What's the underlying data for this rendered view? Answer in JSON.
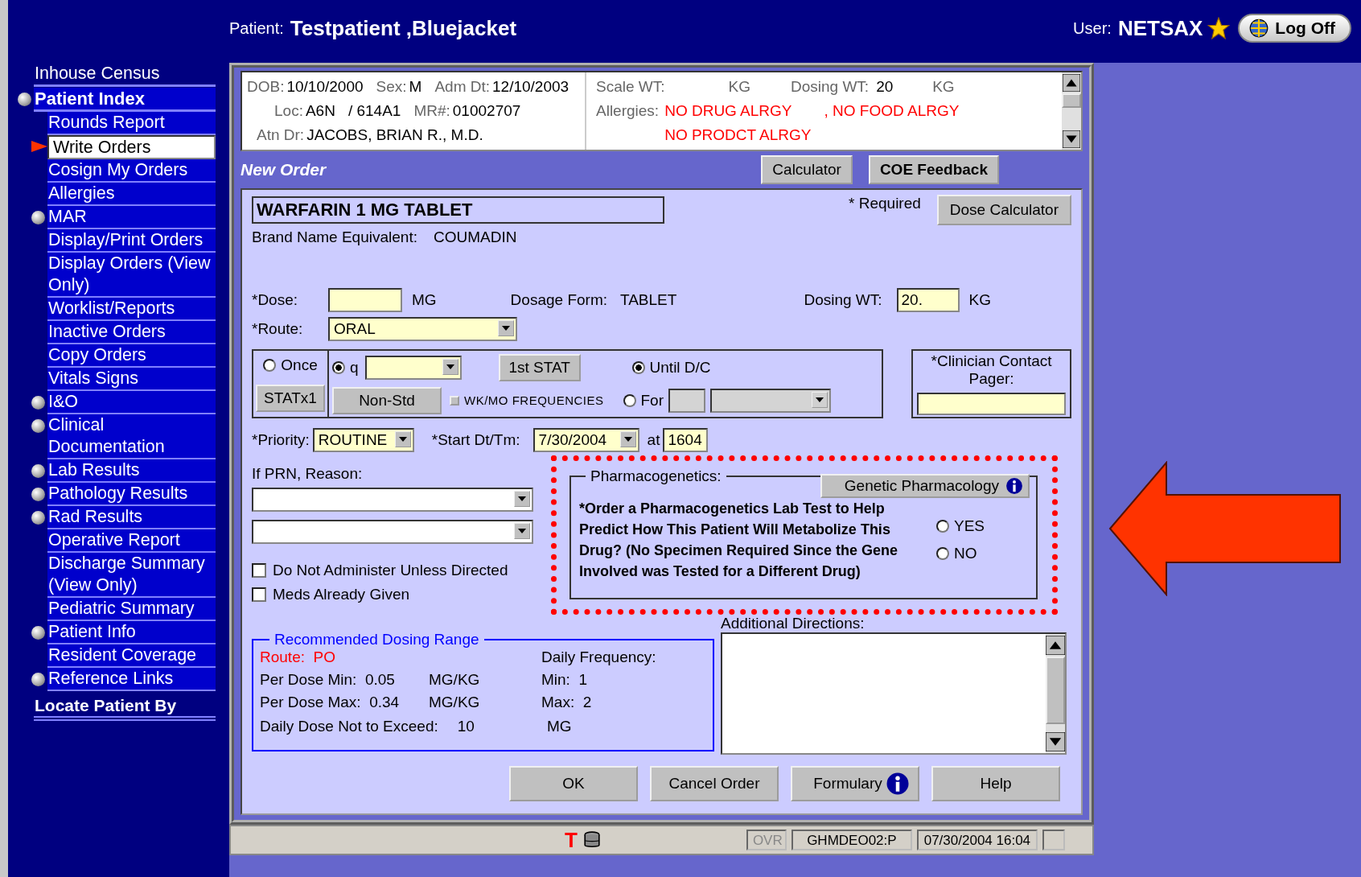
{
  "header": {
    "patient_label": "Patient:",
    "patient_name": "Testpatient ,Bluejacket",
    "user_label": "User:",
    "user_name": "NETSAX",
    "logoff": "Log Off"
  },
  "sidebar": [
    {
      "label": "Inhouse Census",
      "kind": "top",
      "bullet": false,
      "selected": false
    },
    {
      "label": "Patient Index",
      "kind": "section",
      "bullet": true,
      "selected": false
    },
    {
      "label": "Rounds Report",
      "kind": "item",
      "bullet": false,
      "selected": false
    },
    {
      "label": "Write Orders",
      "kind": "item",
      "bullet": false,
      "selected": true
    },
    {
      "label": "Cosign My Orders",
      "kind": "item",
      "bullet": false,
      "selected": false
    },
    {
      "label": "Allergies",
      "kind": "item",
      "bullet": false,
      "selected": false
    },
    {
      "label": "MAR",
      "kind": "item",
      "bullet": true,
      "selected": false
    },
    {
      "label": "Display/Print Orders",
      "kind": "item",
      "bullet": false,
      "selected": false
    },
    {
      "label": "Display Orders (View Only)",
      "kind": "item",
      "bullet": false,
      "selected": false
    },
    {
      "label": "Worklist/Reports",
      "kind": "item",
      "bullet": false,
      "selected": false
    },
    {
      "label": "Inactive Orders",
      "kind": "item",
      "bullet": false,
      "selected": false
    },
    {
      "label": "Copy Orders",
      "kind": "item",
      "bullet": false,
      "selected": false
    },
    {
      "label": "Vitals Signs",
      "kind": "item",
      "bullet": false,
      "selected": false
    },
    {
      "label": "I&O",
      "kind": "item",
      "bullet": true,
      "selected": false
    },
    {
      "label": "Clinical Documentation",
      "kind": "item",
      "bullet": true,
      "selected": false
    },
    {
      "label": "Lab Results",
      "kind": "item",
      "bullet": true,
      "selected": false
    },
    {
      "label": "Pathology Results",
      "kind": "item",
      "bullet": true,
      "selected": false
    },
    {
      "label": "Rad Results",
      "kind": "item",
      "bullet": true,
      "selected": false
    },
    {
      "label": "Operative Report",
      "kind": "item",
      "bullet": false,
      "selected": false
    },
    {
      "label": "Discharge Summary (View Only)",
      "kind": "item",
      "bullet": false,
      "selected": false
    },
    {
      "label": "Pediatric Summary",
      "kind": "item",
      "bullet": false,
      "selected": false
    },
    {
      "label": "Patient Info",
      "kind": "item",
      "bullet": true,
      "selected": false
    },
    {
      "label": "Resident Coverage",
      "kind": "item",
      "bullet": false,
      "selected": false
    },
    {
      "label": "Reference Links",
      "kind": "item",
      "bullet": true,
      "selected": false
    },
    {
      "label": "Locate Patient By",
      "kind": "footer",
      "bullet": false,
      "selected": false
    }
  ],
  "patient_info": {
    "rows": [
      [
        {
          "label": "DOB:",
          "value": "10/10/2000"
        },
        {
          "label": "Sex:",
          "value": "M"
        },
        {
          "label": "Adm Dt:",
          "value": "12/10/2003"
        }
      ],
      [
        {
          "label": "Loc:",
          "value": "A6N"
        },
        {
          "value": "/ 614A1"
        },
        {
          "label": "MR#:",
          "value": "01002707"
        }
      ],
      [
        {
          "label": "Atn Dr:",
          "value": "JACOBS, BRIAN R., M.D."
        }
      ]
    ],
    "weights": [
      {
        "label": "Scale WT:",
        "unit": "KG"
      },
      {
        "label": "Dosing WT:",
        "value": "20",
        "unit": "KG"
      }
    ],
    "allergies_label": "Allergies:",
    "allergies": [
      "NO DRUG ALRGY",
      ", NO FOOD ALRGY",
      "NO PRODCT ALRGY"
    ]
  },
  "new_order": {
    "title": "New Order",
    "buttons": [
      {
        "label": "Calculator",
        "bold": false
      },
      {
        "label": "COE Feedback",
        "bold": true
      }
    ]
  },
  "order": {
    "drug": "WARFARIN 1 MG TABLET",
    "required_note": "* Required",
    "dose_calculator": "Dose Calculator",
    "brand_label": "Brand Name Equivalent:",
    "brand_value": "COUMADIN",
    "dose": {
      "label": "*Dose:",
      "unit": "MG"
    },
    "dosage_form_label": "Dosage Form:",
    "dosage_form_value": "TABLET",
    "dosing_wt": {
      "label": "Dosing WT:",
      "value": "20.",
      "unit": "KG"
    },
    "route": {
      "label": "*Route:",
      "value": "ORAL"
    },
    "frequency": {
      "once": {
        "label": "Once",
        "selected": false
      },
      "q": {
        "label": "q",
        "selected": true
      },
      "statx1": "STATx1",
      "non_std": "Non-Std",
      "first_stat": "1st STAT",
      "wk_mo": {
        "label": "WK/MO FREQUENCIES",
        "checked": false
      },
      "until": {
        "label": "Until D/C",
        "selected": true
      },
      "for": {
        "label": "For",
        "selected": false
      }
    },
    "clinician_label": "*Clinician Contact Pager:",
    "priority": {
      "label": "*Priority:",
      "value": "ROUTINE"
    },
    "start": {
      "label": "*Start Dt/Tm:",
      "date": "7/30/2004",
      "at": "at",
      "time": "1604"
    },
    "prn_label": "If PRN, Reason:",
    "checkboxes": [
      {
        "label": "Do Not Administer Unless Directed",
        "checked": false
      },
      {
        "label": "Meds Already Given",
        "checked": false
      }
    ],
    "pharmacogenetics": {
      "title": "Pharmacogenetics:",
      "button": "Genetic Pharmacology",
      "question": "*Order a Pharmacogenetics Lab Test to Help Predict How This Patient Will Metabolize This Drug?  (No Specimen Required Since the Gene Involved was Tested for a Different Drug)",
      "options": [
        {
          "label": "YES",
          "selected": false
        },
        {
          "label": "NO",
          "selected": false
        }
      ]
    },
    "additional_directions_label": "Additional Directions:",
    "dosing_range": {
      "title": "Recommended Dosing Range",
      "route_label": "Route:",
      "route_value": "PO",
      "frequency_label": "Daily Frequency:",
      "rows": [
        {
          "label": "Per Dose Min:",
          "value": "0.05",
          "unit": "MG/KG",
          "freq_label": "Min:",
          "freq_value": "1"
        },
        {
          "label": "Per Dose Max:",
          "value": "0.34",
          "unit": "MG/KG",
          "freq_label": "Max:",
          "freq_value": "2"
        }
      ],
      "daily_max": {
        "label": "Daily Dose Not to Exceed:",
        "value": "10",
        "unit": "MG"
      }
    },
    "actions": [
      {
        "label": "OK",
        "info": false
      },
      {
        "label": "Cancel Order",
        "info": false
      },
      {
        "label": "Formulary",
        "info": true
      },
      {
        "label": "Help",
        "info": false
      }
    ]
  },
  "status_bar": {
    "t_icon": "T",
    "mode": "OVR",
    "host": "GHMDEO02:P",
    "datetime": "07/30/2004 16:04"
  }
}
